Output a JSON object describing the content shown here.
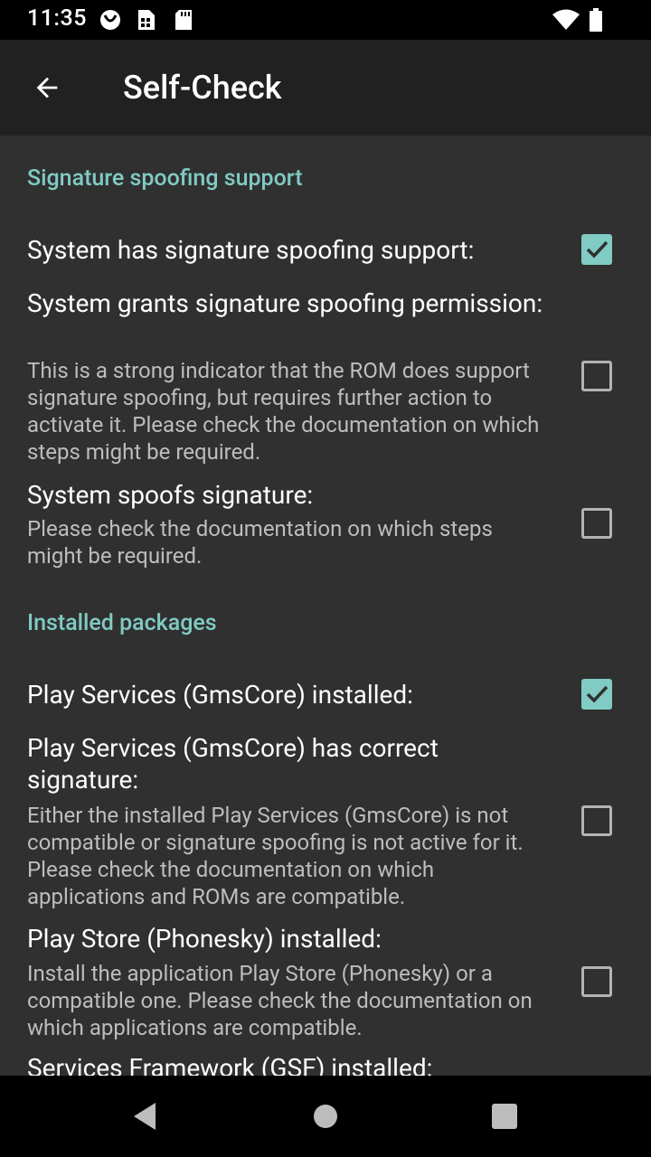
{
  "status_bar": {
    "time": "11:35",
    "icons": [
      "gms-notification-icon",
      "sim-card-icon",
      "sd-card-icon",
      "wifi-icon",
      "battery-icon"
    ]
  },
  "app_bar": {
    "title": "Self-Check",
    "back_icon": "arrow-back-icon"
  },
  "sections": [
    {
      "header": "Signature spoofing support",
      "items": [
        {
          "title": "System has signature spoofing support:",
          "description": "",
          "checked": true
        },
        {
          "title": "System grants signature spoofing permission:",
          "description": "This is a strong indicator that the ROM does support signature spoofing, but requires further action to activate it. Please check the documentation on which steps might be required.",
          "checked": false
        },
        {
          "title": "System spoofs signature:",
          "description": "Please check the documentation on which steps might be required.",
          "checked": false
        }
      ]
    },
    {
      "header": "Installed packages",
      "items": [
        {
          "title": "Play Services (GmsCore) installed:",
          "description": "",
          "checked": true
        },
        {
          "title": "Play Services (GmsCore) has correct signature:",
          "description": "Either the installed Play Services (GmsCore) is not compatible or signature spoofing is not active for it. Please check the documentation on which applications and ROMs are compatible.",
          "checked": false
        },
        {
          "title": "Play Store (Phonesky) installed:",
          "description": "Install the application Play Store (Phonesky) or a compatible one. Please check the documentation on which applications are compatible.",
          "checked": false
        },
        {
          "title": "Services Framework (GSF) installed:",
          "description": "",
          "checked": false
        }
      ]
    }
  ],
  "colors": {
    "accent": "#80cbc4",
    "background": "#303030",
    "app_bar": "#212121",
    "system_bars": "#000000"
  },
  "nav_bar": {
    "back_icon": "nav-back-icon",
    "home_icon": "nav-home-icon",
    "recents_icon": "nav-recents-icon"
  }
}
